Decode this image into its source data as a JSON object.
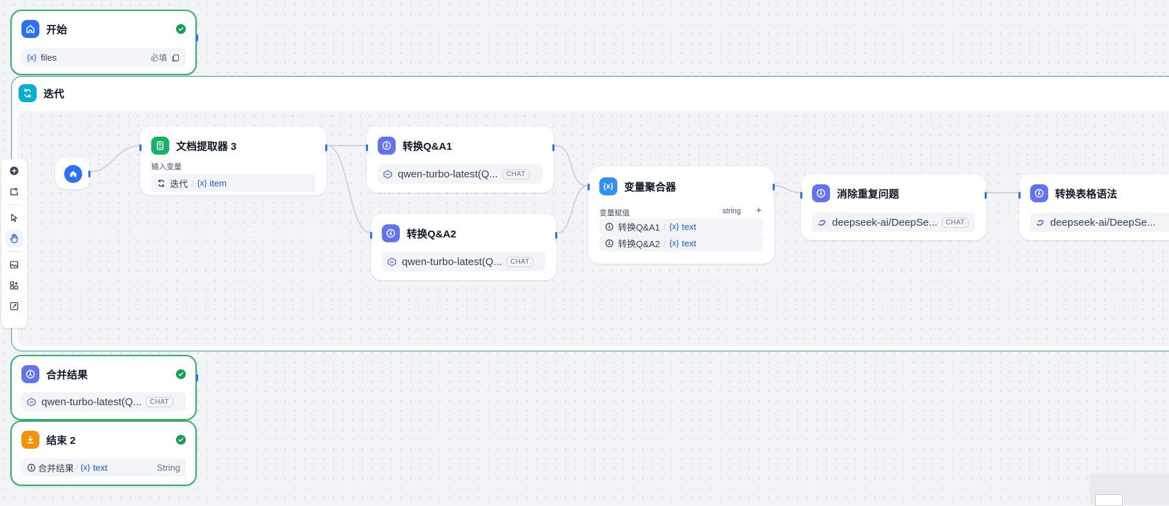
{
  "nodes": {
    "start": {
      "title": "开始",
      "var_name": "files",
      "required_label": "必填"
    },
    "iteration": {
      "title": "迭代"
    },
    "doc_extractor": {
      "title": "文档提取器 3",
      "section_label": "输入变量",
      "src_label": "迭代",
      "var_name": "item"
    },
    "qa1": {
      "title": "转换Q&A1",
      "model": "qwen-turbo-latest(Q...",
      "badge": "CHAT"
    },
    "qa2": {
      "title": "转换Q&A2",
      "model": "qwen-turbo-latest(Q...",
      "badge": "CHAT"
    },
    "aggregator": {
      "title": "变量聚合器",
      "section_label": "变量赋值",
      "type_label": "string",
      "add_label": "+",
      "rows": [
        {
          "src": "转换Q&A1",
          "var": "text"
        },
        {
          "src": "转换Q&A2",
          "var": "text"
        }
      ]
    },
    "dedupe": {
      "title": "消除重复问题",
      "model": "deepseek-ai/DeepSe...",
      "badge": "CHAT"
    },
    "table": {
      "title": "转换表格语法",
      "model": "deepseek-ai/DeepSe..."
    },
    "merge": {
      "title": "合并结果",
      "model": "qwen-turbo-latest(Q...",
      "badge": "CHAT"
    },
    "end": {
      "title": "结束 2",
      "src_label": "合并结果",
      "var_name": "text",
      "type_label": "String"
    }
  },
  "var_prefix": "{x}",
  "colors": {
    "selected_border": "#2eb36b",
    "handle": "#2970ff",
    "start_icon": "#2970ff",
    "iteration_icon": "#06aed4",
    "doc_icon": "#17b26a",
    "llm_icon": "#6172f3",
    "aggregator_icon": "#2e90fa",
    "end_icon": "#f79009",
    "variable_text": "#155aef"
  },
  "toolbar": [
    "add-node-icon",
    "add-note-icon",
    "pointer-icon",
    "hand-icon",
    "export-image-icon",
    "organize-icon",
    "maximize-icon"
  ]
}
